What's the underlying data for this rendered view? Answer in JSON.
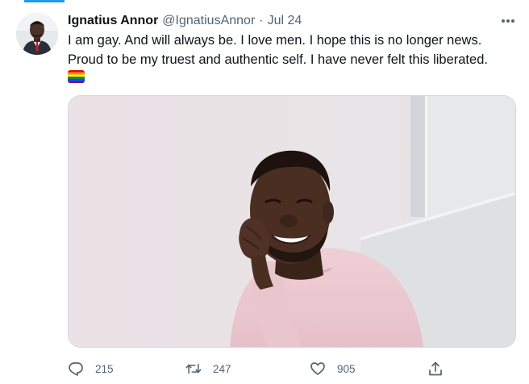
{
  "tweet": {
    "author_name": "Ignatius Annor",
    "author_handle": "@IgnatiusAnnor",
    "separator": "·",
    "date": "Jul 24",
    "text_lines": [
      "I am gay. And will always be. I love men. I hope this is no longer news.",
      "Proud to be my truest and authentic self. I have never felt this liberated."
    ],
    "emoji": "rainbow-flag",
    "media": {
      "description_icon": "photo-man-smiling-pink-sweater"
    }
  },
  "actions": {
    "reply": {
      "icon": "reply-icon",
      "count": "215"
    },
    "retweet": {
      "icon": "retweet-icon",
      "count": "247"
    },
    "like": {
      "icon": "heart-icon",
      "count": "905"
    },
    "share": {
      "icon": "share-icon"
    }
  },
  "colors": {
    "accent": "#1d9bf0",
    "secondary_text": "#536471",
    "primary_text": "#0f1419",
    "border": "#cfd9de"
  }
}
